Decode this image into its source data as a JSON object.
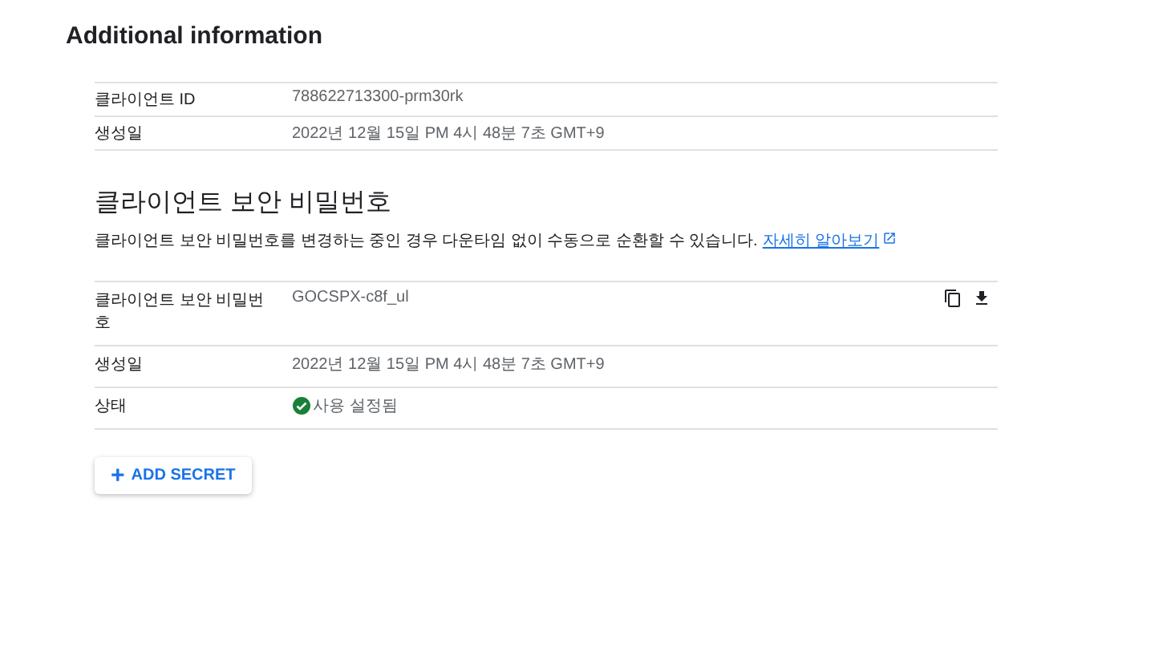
{
  "title": "Additional information",
  "client_rows": [
    {
      "label": "클라이언트 ID",
      "value": "788622713300-prm30rk"
    },
    {
      "label": "생성일",
      "value": "2022년 12월 15일 PM 4시 48분 7초 GMT+9"
    }
  ],
  "secret_section": {
    "heading": "클라이언트 보안 비밀번호",
    "description": "클라이언트 보안 비밀번호를 변경하는 중인 경우 다운타임 없이 수동으로 순환할 수 있습니다.",
    "link": "자세히 알아보기"
  },
  "secret_rows": [
    {
      "kind": "secret",
      "label": "클라이언트 보안 비밀번호",
      "value": "GOCSPX-c8f_ul"
    },
    {
      "kind": "text",
      "label": "생성일",
      "value": "2022년 12월 15일 PM 4시 48분 7초 GMT+9"
    },
    {
      "kind": "status",
      "label": "상태",
      "value": "사용 설정됨"
    }
  ],
  "add_button": {
    "icon": "+",
    "label": "ADD SECRET"
  }
}
